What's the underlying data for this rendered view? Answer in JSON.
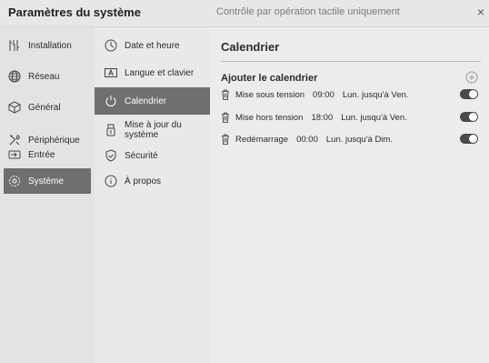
{
  "window": {
    "title": "Paramètres du système",
    "subtitle": "Contrôle par opération tactile uniquement",
    "close_glyph": "×"
  },
  "sidebar": {
    "items": [
      {
        "label": "Installation",
        "icon": "tools-icon"
      },
      {
        "label": "Réseau",
        "icon": "globe-icon"
      },
      {
        "label": "Général",
        "icon": "cube-icon"
      },
      {
        "label": "Périphérique",
        "icon": "wrench-icon"
      },
      {
        "label": "Entrée",
        "icon": "input-icon"
      },
      {
        "label": "Système",
        "icon": "gear-icon",
        "active": true
      }
    ]
  },
  "submenu": {
    "items": [
      {
        "label": "Date et heure",
        "icon": "clock-icon"
      },
      {
        "label": "Langue et clavier",
        "icon": "keyboard-icon"
      },
      {
        "label": "Calendrier",
        "icon": "power-icon",
        "active": true
      },
      {
        "label": "Mise à jour du système",
        "icon": "usb-icon"
      },
      {
        "label": "Sécurité",
        "icon": "shield-icon"
      },
      {
        "label": "À propos",
        "icon": "info-icon"
      }
    ]
  },
  "main": {
    "title": "Calendrier",
    "add_label": "Ajouter le calendrier",
    "schedules": [
      {
        "action": "Mise sous tension",
        "time": "09:00",
        "days": "Lun. jusqu'à Ven.",
        "enabled": true
      },
      {
        "action": "Mise hors tension",
        "time": "18:00",
        "days": "Lun. jusqu'à Ven.",
        "enabled": true
      },
      {
        "action": "Redémarrage",
        "time": "00:00",
        "days": "Lun. jusqu'à Dim.",
        "enabled": true
      }
    ]
  },
  "colors": {
    "active_bg": "#6f6f6f",
    "toggle_on": "#4a4a4a",
    "background": "#e7e7e7"
  }
}
